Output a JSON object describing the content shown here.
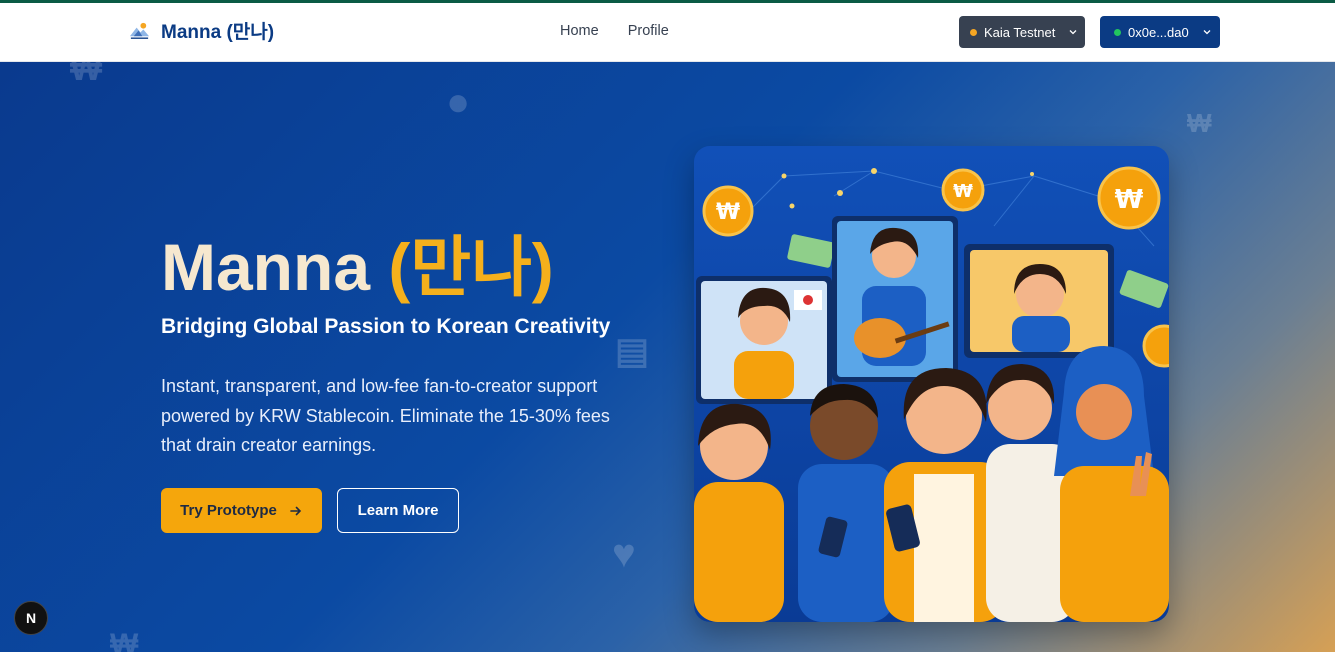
{
  "navbar": {
    "brand_name": "Manna (만나)",
    "links": [
      {
        "label": "Home"
      },
      {
        "label": "Profile"
      }
    ],
    "network": {
      "label": "Kaia Testnet",
      "status_color": "#f5a623",
      "icon": "chevron-down-icon"
    },
    "wallet": {
      "label": "0x0e...da0",
      "status_color": "#22c55e",
      "icon": "chevron-down-icon"
    }
  },
  "hero": {
    "title_main": "Manna",
    "title_korean": "(만나)",
    "subtitle": "Bridging Global Passion to Korean Creativity",
    "description": "Instant, transparent, and low-fee fan-to-creator support powered by KRW Stablecoin. Eliminate the 15-30% fees that drain creator earnings.",
    "primary_button": {
      "label": "Try Prototype",
      "icon": "arrow-right-icon"
    },
    "secondary_button": {
      "label": "Learn More"
    },
    "illustration": {
      "icon": "fans-and-creators-illustration"
    }
  },
  "dev_badge": {
    "label": "N"
  },
  "colors": {
    "brand_navy": "#0b3b84",
    "accent_gold": "#f5a60c",
    "hero_blue": "#0a3a8e",
    "network_button": "#374151"
  }
}
